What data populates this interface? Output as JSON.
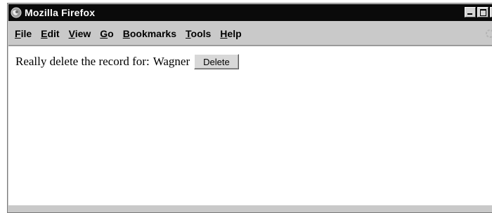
{
  "window": {
    "title": "Mozilla Firefox"
  },
  "menubar": {
    "items": [
      {
        "accel": "F",
        "rest": "ile"
      },
      {
        "accel": "E",
        "rest": "dit"
      },
      {
        "accel": "V",
        "rest": "iew"
      },
      {
        "accel": "G",
        "rest": "o"
      },
      {
        "accel": "B",
        "rest": "ookmarks"
      },
      {
        "accel": "T",
        "rest": "ools"
      },
      {
        "accel": "H",
        "rest": "elp"
      }
    ]
  },
  "content": {
    "prompt": "Really delete the record for:",
    "record_name": "Wagner",
    "delete_label": "Delete"
  },
  "colors": {
    "titlebar": "#0a0a0a",
    "chrome": "#c9c9c9",
    "page_background": "#ffffff"
  },
  "icons": {
    "app": "firefox-globe-icon",
    "throbber": "activity-throbber-icon"
  }
}
